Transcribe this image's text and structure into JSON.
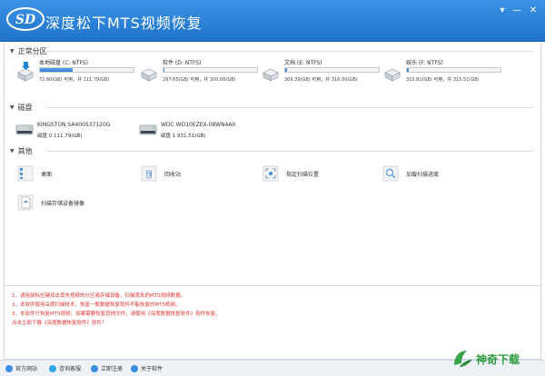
{
  "app": {
    "title": "深度松下MTS视频恢复",
    "logo_text": "SD"
  },
  "window_buttons": [
    "▾",
    "—",
    "✕"
  ],
  "sections": {
    "partitions": "正常分区",
    "disks": "磁盘",
    "others": "其他"
  },
  "partitions": [
    {
      "name": "本地磁盘 (C: NTFS)",
      "info": "72.60(GB) 可用，共 111.79(GB)",
      "used_pct": 35
    },
    {
      "name": "软件 (D: NTFS)",
      "info": "297.65(GB) 可用，共 300.00(GB)",
      "used_pct": 1
    },
    {
      "name": "文档 (E: NTFS)",
      "info": "309.39(GB) 可用，共 316.00(GB)",
      "used_pct": 2
    },
    {
      "name": "娱乐 (F: NTFS)",
      "info": "310.81(GB) 可用，共 315.51(GB)",
      "used_pct": 2
    }
  ],
  "disks": [
    {
      "model": "KINGSTON SA400S37120G",
      "sub": "磁盘 0    111.79(GB)"
    },
    {
      "model": "WDC WD10EZEX-08WN4A0",
      "sub": "磁盘 1    931.51(GB)"
    }
  ],
  "others": [
    {
      "label": "桌面",
      "icon": "desktop-icon"
    },
    {
      "label": "回收站",
      "icon": "recycle-bin-icon"
    },
    {
      "label": "指定扫描位置",
      "icon": "scan-location-icon"
    },
    {
      "label": "加载扫描进度",
      "icon": "load-progress-icon"
    },
    {
      "label": "扫描存储设备镜像",
      "icon": "disk-image-icon"
    }
  ],
  "notes": [
    "1，请用鼠标左键双击丢失视频的分区或存储设备，扫描丢失的MTS视频数据。",
    "2，本软件使用深度扫描技术，恢复一般数据恢复软件不能恢复的MTS视频。",
    "3，本软件只恢复MTS视频，如果需要恢复其他文件，请使用《深度数据恢复软件》软件恢复。",
    "    点击立即下载《深度数据恢复软件》软件！"
  ],
  "footer": {
    "website": "官方网站",
    "support": "咨询客服",
    "register": "立即注册",
    "about": "关于软件"
  },
  "watermark": {
    "text": "神奇下载"
  },
  "colors": {
    "title_bar": "#2a84dc",
    "bar_fill": "#3b8de0",
    "note_text": "#e03131",
    "watermark": "#2e9a3e"
  }
}
